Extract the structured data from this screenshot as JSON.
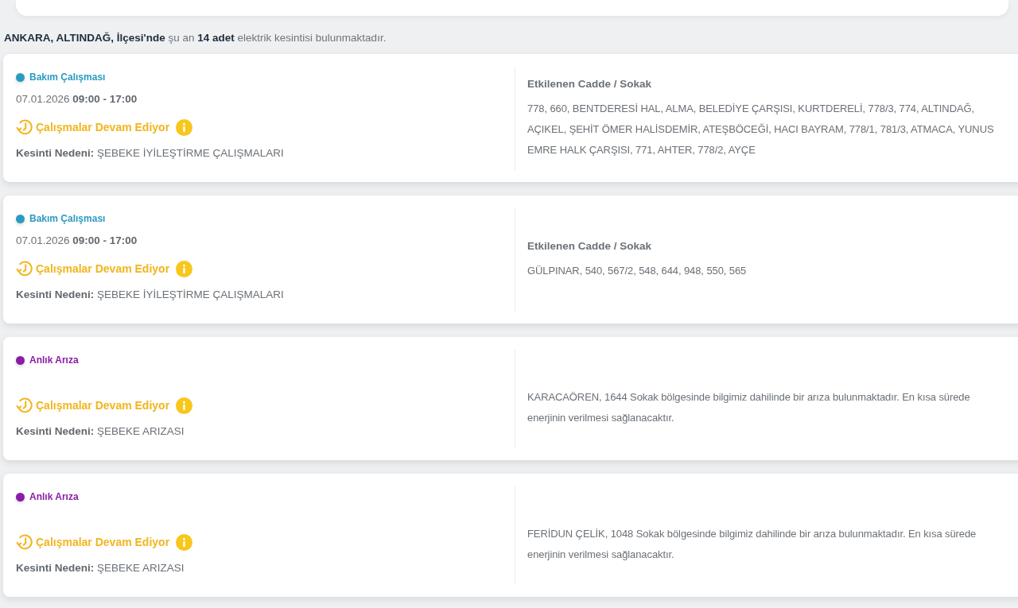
{
  "summary": "**ANKARA, ALTINDAĞ, İlçesi'nde** şu an **14 adet** elektrik kesintisi bulunmaktadır.",
  "outages": [
    {
      "category": "Bakım Çalışması",
      "color": "#2a9bc0",
      "date": "07.01.2026 **09:00 - 17:00**",
      "status": "Çalışmalar Devam Ediyor",
      "reason": "**Kesinti Nedeni:** ŞEBEKE İYİLEŞTİRME ÇALIŞMALARI",
      "right": {
        "heading": "Etkilenen Cadde / Sokak",
        "text": "778, 660, BENTDERESİ HAL, ALMA, BELEDİYE ÇARŞISI, KURTDERELİ, 778/3, 774, ALTINDAĞ, AÇIKEL, ŞEHİT ÖMER HALİSDEMİR, ATEŞBÖCEĞİ, HACI BAYRAM, 778/1, 781/3, ATMACA, YUNUS EMRE HALK ÇARŞISI, 771, AHTER, 778/2, AYÇE"
      }
    },
    {
      "category": "Bakım Çalışması",
      "color": "#2a9bc0",
      "date": "07.01.2026 **09:00 - 17:00**",
      "status": "Çalışmalar Devam Ediyor",
      "reason": "**Kesinti Nedeni:** ŞEBEKE İYİLEŞTİRME ÇALIŞMALARI",
      "right": {
        "heading": "Etkilenen Cadde / Sokak",
        "text": "GÜLPINAR, 540, 567/2, 548, 644, 948, 550, 565"
      }
    },
    {
      "category": "Anlık Arıza",
      "color": "#8a1ca8",
      "status": "Çalışmalar Devam Ediyor",
      "reason": "**Kesinti Nedeni:** ŞEBEKE ARIZASI",
      "right": {
        "text": "KARACAÖREN, 1644 Sokak bölgesinde bilgimiz dahilinde bir arıza bulunmaktadır. En kısa sürede enerjinin verilmesi sağlanacaktır."
      }
    },
    {
      "category": "Anlık Arıza",
      "color": "#8a1ca8",
      "status": "Çalışmalar Devam Ediyor",
      "reason": "**Kesinti Nedeni:** ŞEBEKE ARIZASI",
      "right": {
        "text": "FERİDUN ÇELİK, 1048 Sokak bölgesinde bilgimiz dahilinde bir arıza bulunmaktadır. En kısa sürede enerjinin verilmesi sağlanacaktır."
      }
    }
  ]
}
